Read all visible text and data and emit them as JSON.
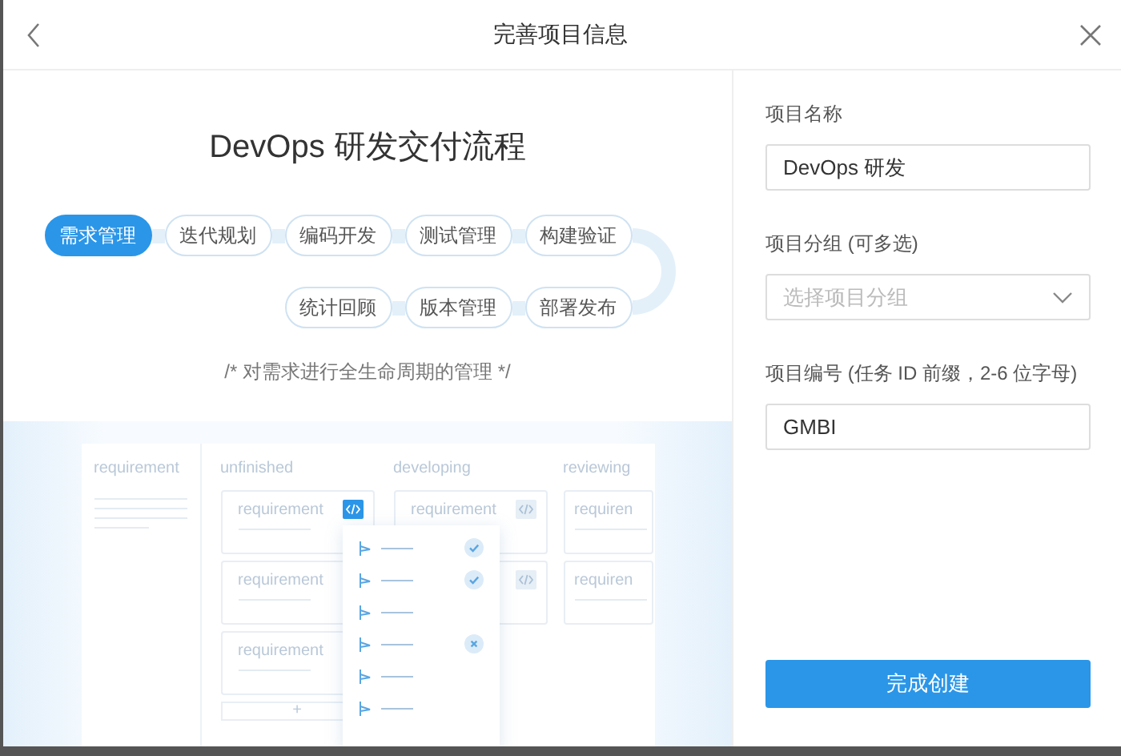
{
  "window": {
    "title": "完善项目信息"
  },
  "flow": {
    "title": "DevOps 研发交付流程",
    "steps_row_1": [
      {
        "label": "需求管理",
        "selected": true
      },
      {
        "label": "迭代规划",
        "selected": false
      },
      {
        "label": "编码开发",
        "selected": false
      },
      {
        "label": "测试管理",
        "selected": false
      },
      {
        "label": "构建验证",
        "selected": false
      }
    ],
    "steps_row_2": [
      {
        "label": "统计回顾",
        "selected": false
      },
      {
        "label": "版本管理",
        "selected": false
      },
      {
        "label": "部署发布",
        "selected": false
      }
    ],
    "caption": "/* 对需求进行全生命周期的管理 */"
  },
  "illustration": {
    "sidebar_title": "requirement",
    "columns": [
      {
        "title": "unfinished",
        "add_button": "+",
        "cards": [
          {
            "label": "requirement",
            "code_tag_highlighted": true
          },
          {
            "label": "requirement"
          },
          {
            "label": "requirement"
          }
        ]
      },
      {
        "title": "developing",
        "cards": [
          {
            "label": "requirement",
            "code_tag_highlighted": false
          },
          {
            "code_tag_highlighted": false
          }
        ]
      },
      {
        "title": "reviewing",
        "cards": [
          {
            "label": "requiren"
          },
          {
            "label": "requiren"
          }
        ]
      }
    ],
    "popup_items": [
      {
        "kind": "done"
      },
      {
        "kind": "done"
      },
      {
        "kind": "none"
      },
      {
        "kind": "failed"
      },
      {
        "kind": "none"
      },
      {
        "kind": "none"
      }
    ]
  },
  "form": {
    "fields": [
      {
        "kind": "text",
        "label": "项目名称",
        "value": "DevOps 研发"
      },
      {
        "kind": "select",
        "label": "项目分组 (可多选)",
        "placeholder": "选择项目分组"
      },
      {
        "kind": "text",
        "label": "项目编号 (任务 ID 前缀，2-6 位字母)",
        "value": "GMBI"
      }
    ],
    "submit": "完成创建"
  }
}
